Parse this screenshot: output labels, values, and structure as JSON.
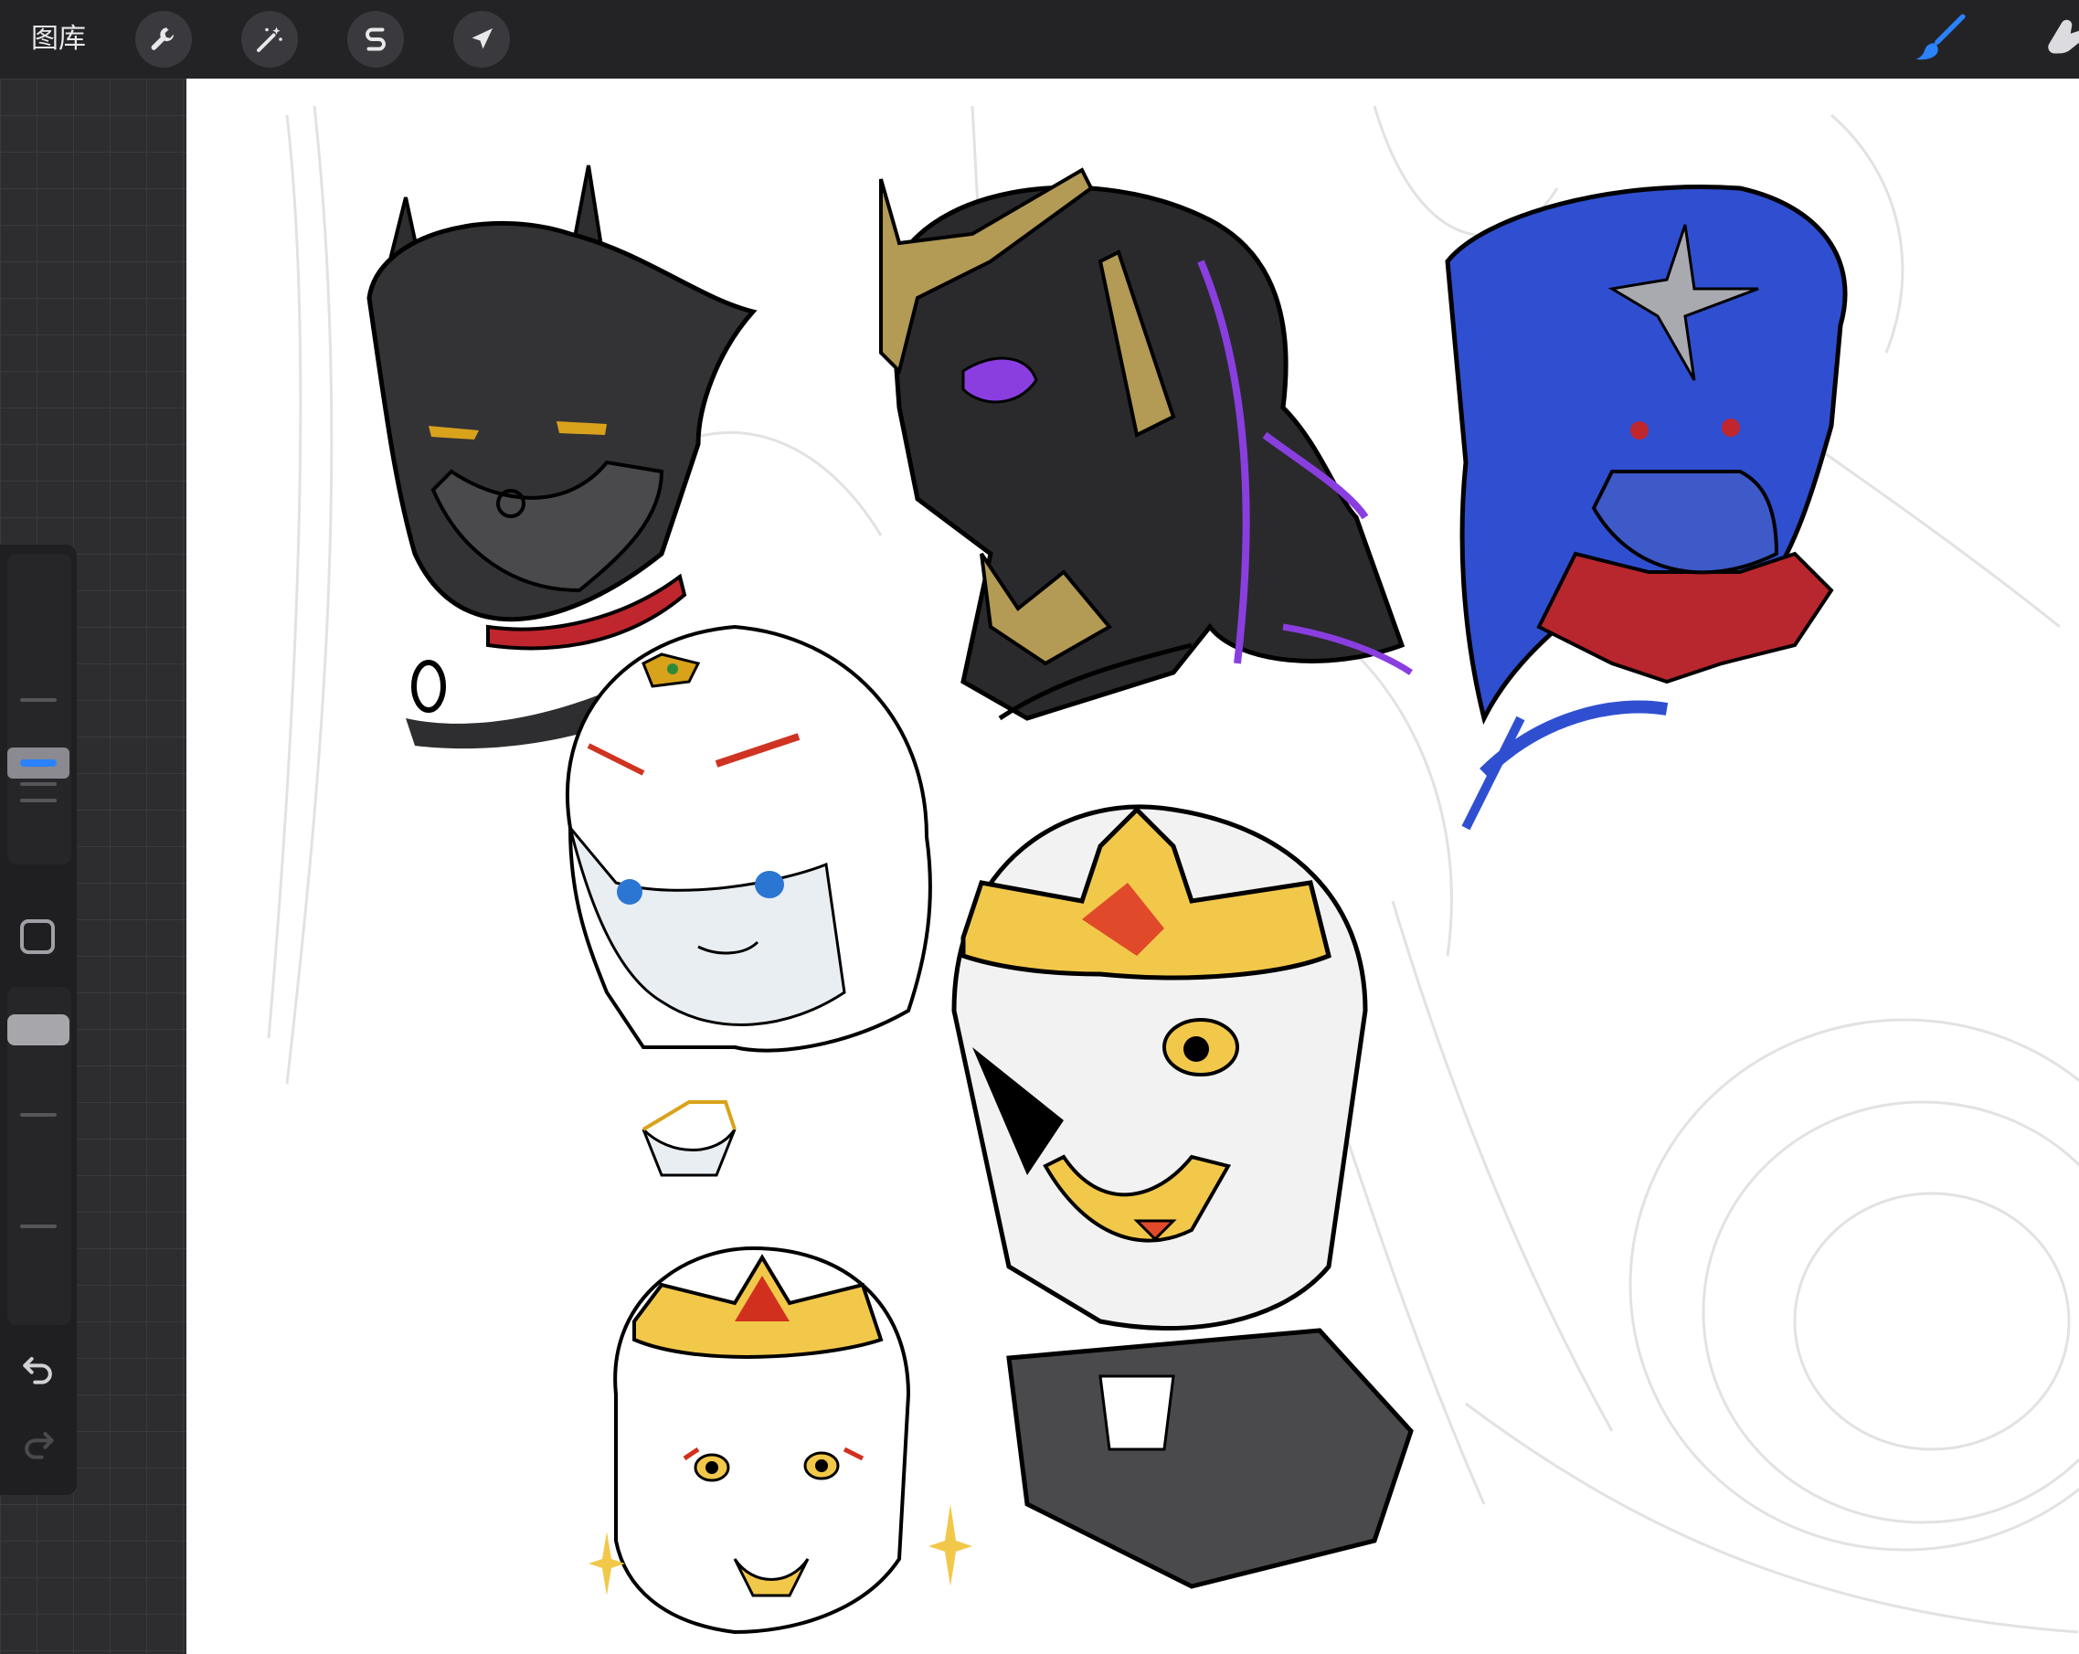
{
  "toolbar": {
    "gallery_label": "图库",
    "left_tools": [
      {
        "name": "actions-wrench-icon"
      },
      {
        "name": "adjustments-magic-wand-icon"
      },
      {
        "name": "selection-s-icon"
      },
      {
        "name": "transform-arrow-icon"
      }
    ],
    "right_tools": [
      {
        "name": "brush-icon",
        "active": true,
        "color": "#2a82ff"
      },
      {
        "name": "smudge-icon",
        "active": false
      }
    ]
  },
  "sidebar": {
    "brush_size_slider": {
      "label": "brush-size"
    },
    "modify_button": {
      "name": "square-modify-icon"
    },
    "opacity_slider": {
      "label": "brush-opacity"
    },
    "undo": {
      "name": "undo-icon"
    },
    "redo": {
      "name": "redo-icon",
      "enabled": false
    }
  },
  "canvas": {
    "background": "#ffffff",
    "sketches": [
      {
        "id": "horned-masked-character",
        "palette": [
          "#2e2e30",
          "#d9a21b",
          "#c0262e"
        ]
      },
      {
        "id": "crowned-purple-eye-character",
        "palette": [
          "#2a2a2c",
          "#b39a55",
          "#8a3ee0"
        ]
      },
      {
        "id": "blue-haired-character",
        "palette": [
          "#2f4fd0",
          "#b8262e",
          "#a9aab0"
        ]
      },
      {
        "id": "white-haired-blue-eye-girl",
        "palette": [
          "#e8eef2",
          "#2a76d2",
          "#cf3321"
        ]
      },
      {
        "id": "golden-crown-armored-character",
        "palette": [
          "#f2c84a",
          "#e0492a",
          "#f2f2f2"
        ]
      },
      {
        "id": "small-crowned-girl",
        "palette": [
          "#f2c84a",
          "#d2301f",
          "#ffffff"
        ]
      }
    ]
  }
}
